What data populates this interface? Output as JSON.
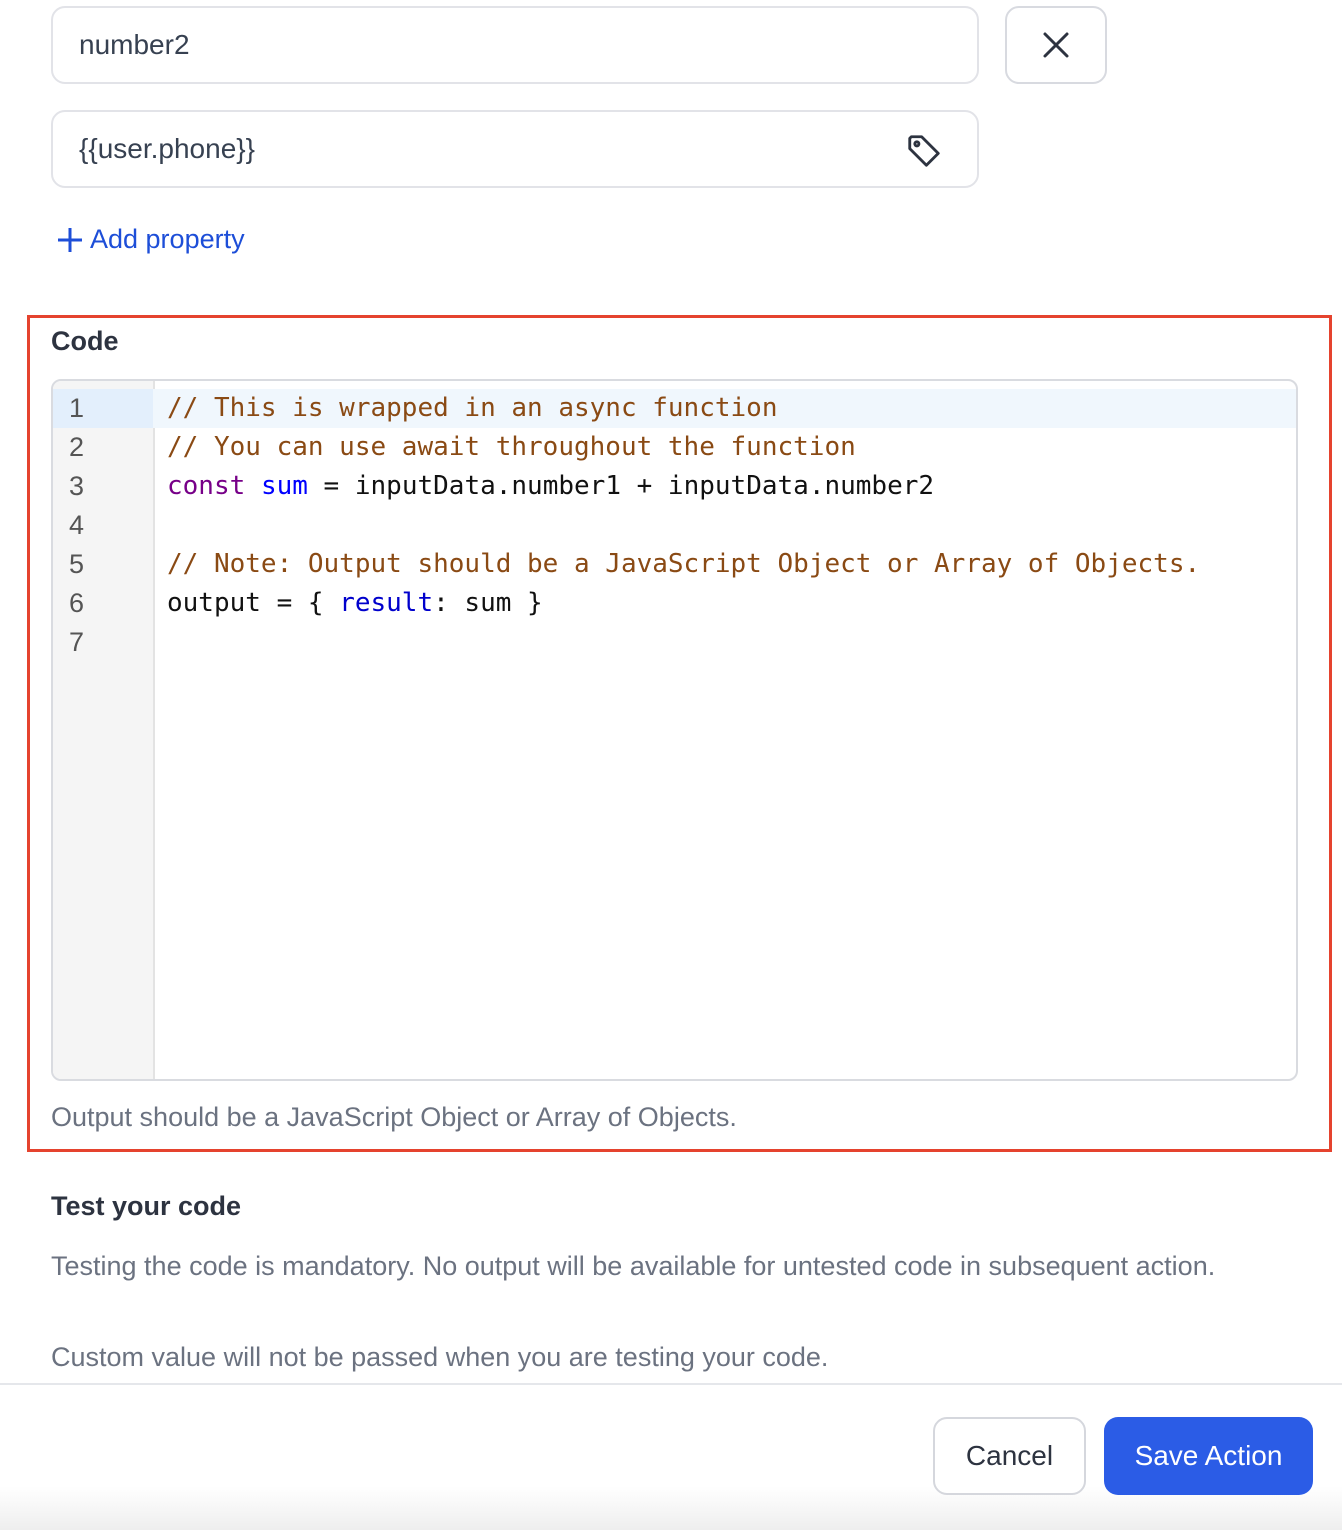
{
  "property": {
    "key_value": "number2",
    "value_value": "{{user.phone}}",
    "add_label": "Add property"
  },
  "code_section": {
    "label": "Code",
    "help": "Output should be a JavaScript Object or Array of Objects.",
    "lines": [
      {
        "n": "1",
        "tokens": [
          {
            "t": "// This is wrapped in an async function",
            "c": "c"
          }
        ]
      },
      {
        "n": "2",
        "tokens": [
          {
            "t": "// You can use await throughout the function",
            "c": "c"
          }
        ]
      },
      {
        "n": "3",
        "tokens": [
          {
            "t": "const",
            "c": "k"
          },
          {
            "t": " "
          },
          {
            "t": "sum",
            "c": "v"
          },
          {
            "t": " = inputData.number1 + inputData.number2"
          }
        ]
      },
      {
        "n": "4",
        "tokens": []
      },
      {
        "n": "5",
        "tokens": [
          {
            "t": "// Note: Output should be a JavaScript Object or Array of Objects.",
            "c": "c"
          }
        ]
      },
      {
        "n": "6",
        "tokens": [
          {
            "t": "output = { "
          },
          {
            "t": "result",
            "c": "p"
          },
          {
            "t": ": sum }"
          }
        ]
      },
      {
        "n": "7",
        "tokens": []
      }
    ]
  },
  "test": {
    "title": "Test your code",
    "desc1": "Testing the code is mandatory. No output will be available for untested code in subsequent action.",
    "desc2": "Custom value will not be passed when you are testing your code."
  },
  "footer": {
    "cancel": "Cancel",
    "save": "Save Action"
  },
  "colors": {
    "accent": "#2b5ce6",
    "highlight_border": "#e5432e"
  }
}
